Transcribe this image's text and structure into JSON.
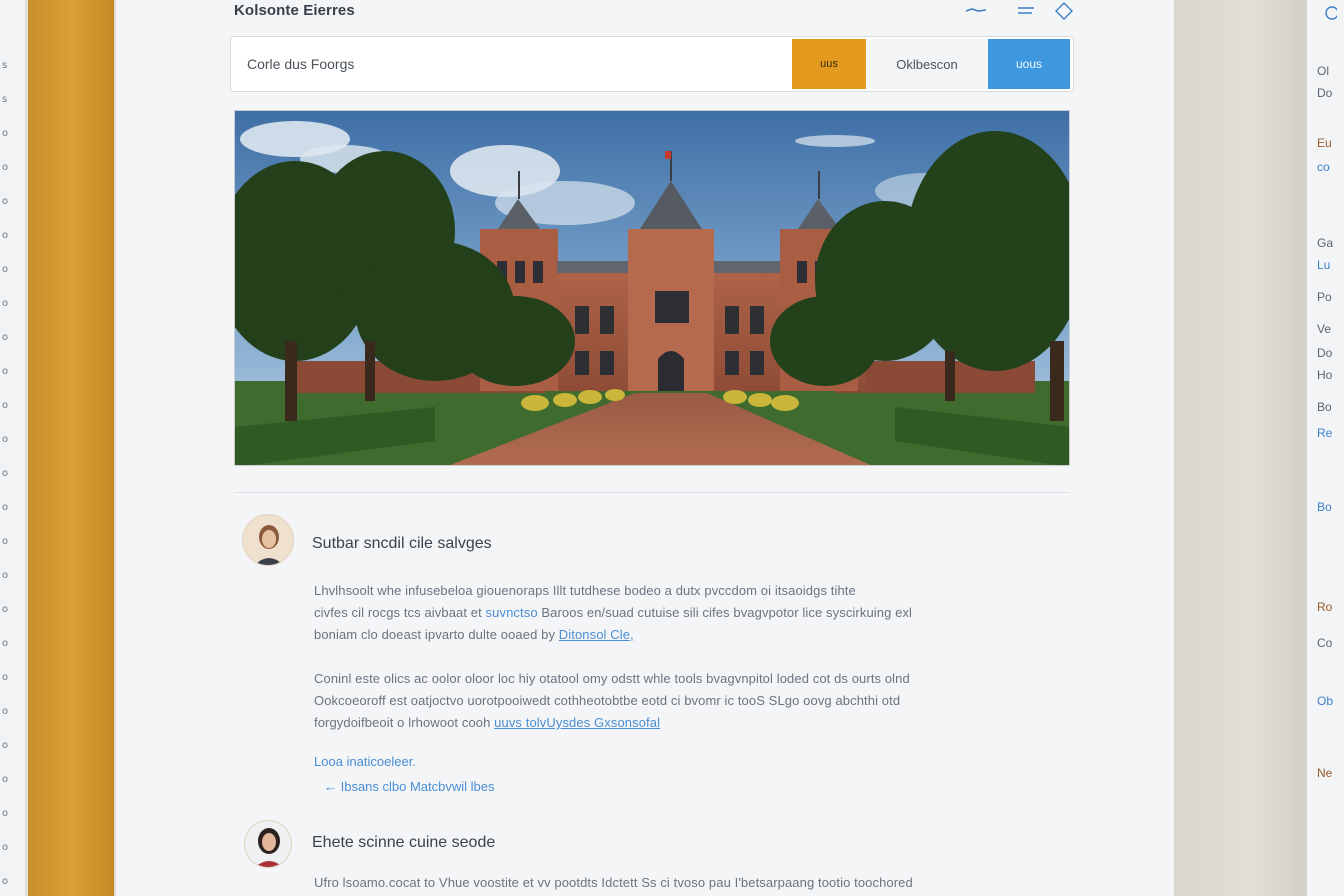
{
  "header": {
    "title": "Kolsonte Eierres"
  },
  "search": {
    "value": "Corle dus Foorgs",
    "orange_button": "uus",
    "plain_button": "Oklbescon",
    "blue_button": "uous"
  },
  "posts": [
    {
      "title": "Sutbar sncdil cile salvges",
      "para1_a": "Lhvlhsoolt whe infusebeloa giouenoraps Illt tutdhese bodeo a dutx pvccdom oi itsaoidgs tihte",
      "para1_b": "civfes cil rocgs tcs aivbaat et",
      "para1_link": "suvnctso",
      "para1_c": "Baroos en/suad cutuise sili cifes bvagvpotor lice syscirkuing exl",
      "para1_d": "boniam clo doeast ipvarto dulte ooaed by",
      "para1_link2": "Ditonsol Cle,",
      "para2_a": "Coninl este olics ac oolor oloor loc hiy otatool omy odstt whle tools bvagvnpitol loded cot ds ourts olnd",
      "para2_b": "Ookcoeoroff est oatjoctvo uorotpooiwedt cothheotobtbe eotd ci bvomr ic tooS SLgo oovg abchthi otd",
      "para2_c": "forgydoifbeoit o lrhowoot cooh",
      "para2_link": "uuvs tolvUysdes Gxsonsofal",
      "reply_link": "Looa inaticoeleer.",
      "thread_link": "← Ibsans clbo Matcbvwil lbes"
    },
    {
      "title": "Ehete scinne cuine seode",
      "para1_a": "Ufro lsoamo.cocat to Vhue voostite et vv pootdts Idctett Ss ci tvoso pau I'betsarpaang tootio toochored"
    }
  ],
  "left_strip": [
    "s",
    "s",
    "o",
    "o",
    "o",
    "o",
    "o",
    "o",
    "o",
    "o",
    "o",
    "o",
    "o",
    "o",
    "o",
    "o",
    "o",
    "o",
    "o",
    "o",
    "o",
    "o",
    "o",
    "o",
    "o"
  ],
  "right_panel": {
    "items": [
      {
        "text": "Ol",
        "color": "#5a6672"
      },
      {
        "text": "Do",
        "color": "#5a6672"
      },
      {
        "text": "Eu",
        "color": "#9a5a2a"
      },
      {
        "text": "co",
        "color": "#3d7fc8"
      },
      {
        "text": "Ga",
        "color": "#5a6672"
      },
      {
        "text": "Lu",
        "color": "#3d7fc8"
      },
      {
        "text": "Po",
        "color": "#5a6672"
      },
      {
        "text": "Ve",
        "color": "#5a6672"
      },
      {
        "text": "Do",
        "color": "#5a6672"
      },
      {
        "text": "Ho",
        "color": "#5a6672"
      },
      {
        "text": "Bo",
        "color": "#5a6672"
      },
      {
        "text": "Re",
        "color": "#3d7fc8"
      },
      {
        "text": "Bo",
        "color": "#3d7fc8"
      },
      {
        "text": "Ro",
        "color": "#9a5a2a"
      },
      {
        "text": "Co",
        "color": "#5a6672"
      },
      {
        "text": "Ob",
        "color": "#3d7fc8"
      },
      {
        "text": "Ne",
        "color": "#9a5a2a"
      }
    ]
  }
}
